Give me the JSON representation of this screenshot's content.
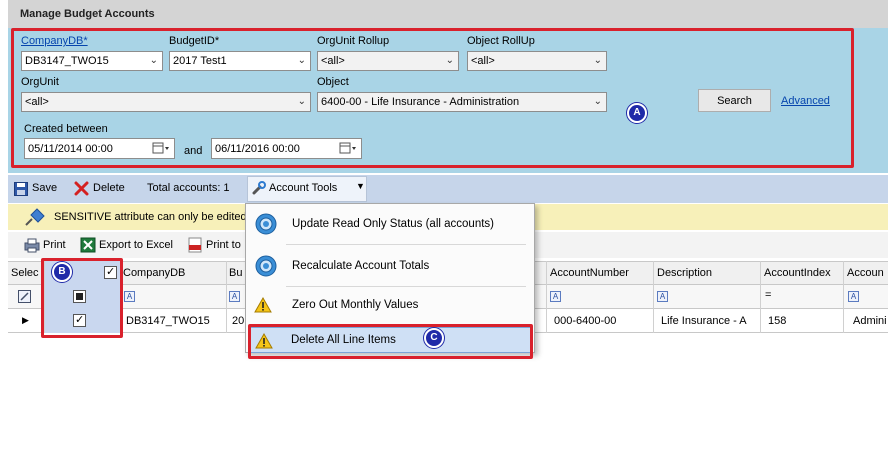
{
  "title": "Manage Budget Accounts",
  "filters": {
    "company_db": {
      "label": "CompanyDB*",
      "value": "DB3147_TWO15"
    },
    "budget_id": {
      "label": "BudgetID*",
      "value": "2017 Test1"
    },
    "orgunit_rollup": {
      "label": "OrgUnit Rollup",
      "value": "<all>"
    },
    "object_rollup": {
      "label": "Object RollUp",
      "value": "<all>"
    },
    "orgunit": {
      "label": "OrgUnit",
      "value": "<all>"
    },
    "object": {
      "label": "Object",
      "value": "6400-00 - Life Insurance - Administration"
    },
    "created_between": {
      "label": "Created between",
      "from": "05/11/2014  00:00",
      "and_label": "and",
      "to": "06/11/2016  00:00"
    },
    "search_label": "Search",
    "advanced_label": "Advanced"
  },
  "toolbar": {
    "save_label": "Save",
    "delete_label": "Delete",
    "total_accounts": "Total accounts: 1",
    "account_tools_label": "Account Tools"
  },
  "sensitive_message": "SENSITIVE attribute can only be edited b",
  "printbar": {
    "print_label": "Print",
    "export_label": "Export to Excel",
    "print_to_label": "Print to"
  },
  "grid": {
    "headers": {
      "select": "Selec",
      "company_db": "CompanyDB",
      "budget": "Bu",
      "account_number": "AccountNumber",
      "description": "Description",
      "account_index": "AccountIndex",
      "account": "Accoun"
    },
    "row": {
      "company_db": "DB3147_TWO15",
      "budget": "20",
      "account_number": "000-6400-00",
      "description": "Life Insurance - A",
      "account_index": "158",
      "account": "Admini"
    }
  },
  "menu": {
    "items": [
      {
        "label": "Update Read Only Status (all accounts)",
        "icon": "gear-icon"
      },
      {
        "label": "Recalculate Account Totals",
        "icon": "gear-icon"
      },
      {
        "label": "Zero Out  Monthly Values",
        "icon": "warning-icon"
      },
      {
        "label": "Delete All Line Items",
        "icon": "warning-icon"
      }
    ]
  },
  "badges": {
    "a": "A",
    "b": "B",
    "c": "C"
  },
  "colors": {
    "highlight_red": "#d9212c",
    "badge_blue": "#1f2aa8",
    "panel_blue": "#a9d4e6",
    "toolbar_blue": "#c6d5ea"
  }
}
